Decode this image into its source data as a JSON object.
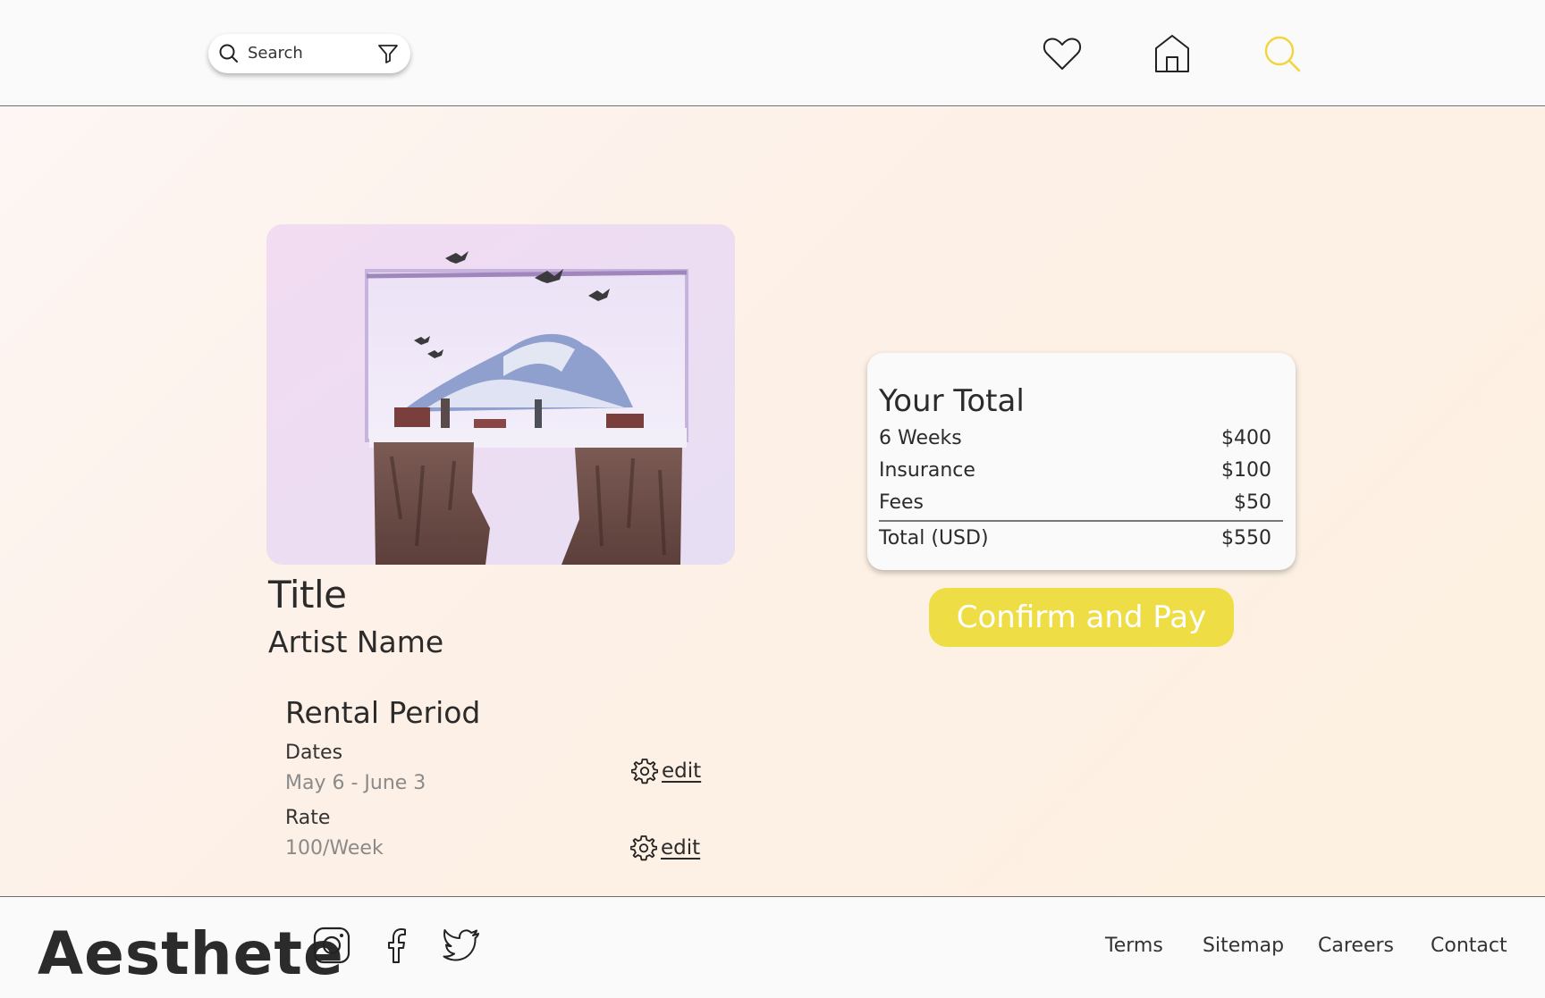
{
  "header": {
    "search_placeholder": "Search",
    "icons": [
      "search-icon",
      "filter-icon",
      "heart-icon",
      "home-icon",
      "search-nav-icon"
    ],
    "active_color": "#f2d53c"
  },
  "artwork": {
    "title": "Title",
    "artist": "Artist Name"
  },
  "rental": {
    "heading": "Rental Period",
    "dates_label": "Dates",
    "dates_value": "May 6 - June 3",
    "rate_label": "Rate",
    "rate_value": "100/Week",
    "edit_label": "edit"
  },
  "total": {
    "heading": "Your Total",
    "rows": [
      {
        "label": "6 Weeks",
        "amount": "$400"
      },
      {
        "label": "Insurance",
        "amount": "$100"
      },
      {
        "label": "Fees",
        "amount": "$50"
      },
      {
        "label": "Total (USD)",
        "amount": "$550"
      }
    ],
    "confirm_label": "Confirm and Pay",
    "confirm_color": "#efdd45"
  },
  "footer": {
    "brand": "Aesthete",
    "social": [
      "instagram-icon",
      "facebook-icon",
      "twitter-icon"
    ],
    "links": [
      "Terms",
      "Sitemap",
      "Careers",
      "Contact"
    ]
  }
}
